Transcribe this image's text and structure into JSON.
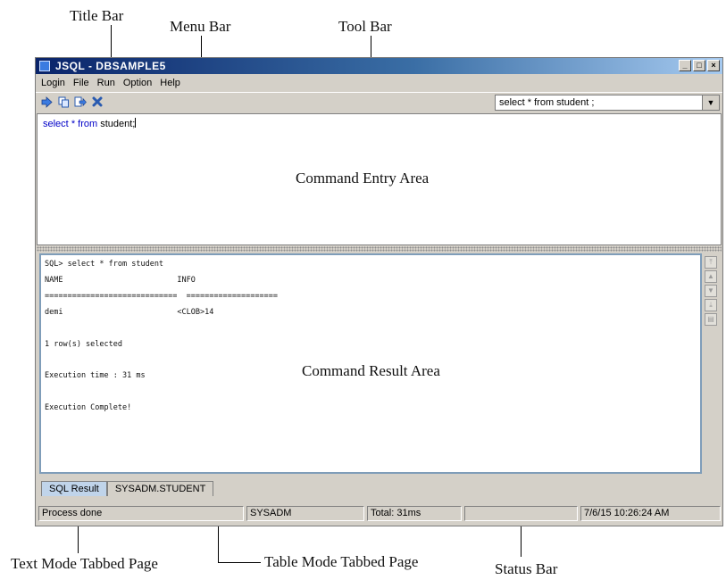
{
  "annotations": {
    "title_bar": "Title Bar",
    "menu_bar": "Menu Bar",
    "tool_bar": "Tool Bar",
    "command_entry_area": "Command Entry Area",
    "command_result_area": "Command Result Area",
    "text_mode_tabbed_page": "Text Mode Tabbed Page",
    "table_mode_tabbed_page": "Table Mode Tabbed Page",
    "status_bar": "Status Bar"
  },
  "window": {
    "title": "JSQL - DBSAMPLE5",
    "controls": {
      "minimize": "_",
      "maximize": "□",
      "close": "×"
    }
  },
  "menu": {
    "items": [
      "Login",
      "File",
      "Run",
      "Option",
      "Help"
    ]
  },
  "toolbar": {
    "icons": [
      "run-icon",
      "copy-icon",
      "export-icon",
      "stop-icon"
    ],
    "command_history_value": "select * from student ;"
  },
  "editor": {
    "kw_select": "select",
    "kw_star": "*",
    "kw_from": "from",
    "table": "student;"
  },
  "result": {
    "lines": [
      "SQL> select * from student",
      "NAME                         INFO",
      "=============================  ====================",
      "demi                         <CLOB>14",
      "1 row(s) selected",
      "Execution time : 31 ms",
      "Execution Complete!"
    ]
  },
  "tabs": [
    "SQL Result",
    "SYSADM.STUDENT"
  ],
  "status": {
    "message": "Process done",
    "user": "SYSADM",
    "total": "Total: 31ms",
    "blank": "",
    "datetime": "7/6/15 10:26:24 AM"
  },
  "colors": {
    "titlebar_start": "#0a246a",
    "titlebar_end": "#a6caf0",
    "keyword": "#0000c8"
  }
}
